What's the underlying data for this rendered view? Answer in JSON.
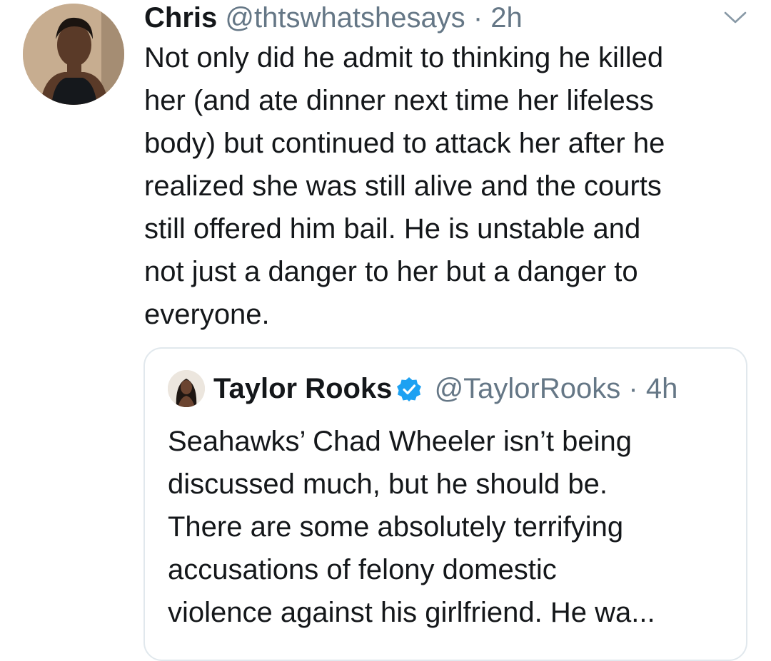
{
  "tweet": {
    "display_name": "Chris",
    "handle": "@thtswhatshesays",
    "separator": "·",
    "time": "2h",
    "more_icon": "chevron-down-icon",
    "text_lines": [
      "Not only did he admit to thinking he killed",
      "her (and ate dinner next time her lifeless",
      "body) but continued to attack her after he",
      "realized she was still alive and the courts",
      "still offered him bail. He is unstable and",
      "not just a danger to her but a danger to",
      "everyone."
    ]
  },
  "quote": {
    "display_name": "Taylor Rooks",
    "verified_icon": "verified-badge-icon",
    "handle": "@TaylorRooks",
    "separator": "·",
    "time": "4h",
    "text_lines": [
      "Seahawks’ Chad Wheeler isn’t being",
      "discussed much, but he should be.",
      "There are some absolutely terrifying",
      "accusations of felony domestic",
      "violence against his girlfriend. He wa..."
    ]
  },
  "colors": {
    "text": "#14171a",
    "secondary": "#657786",
    "border": "#e1e8ed",
    "verified": "#1da1f2"
  }
}
